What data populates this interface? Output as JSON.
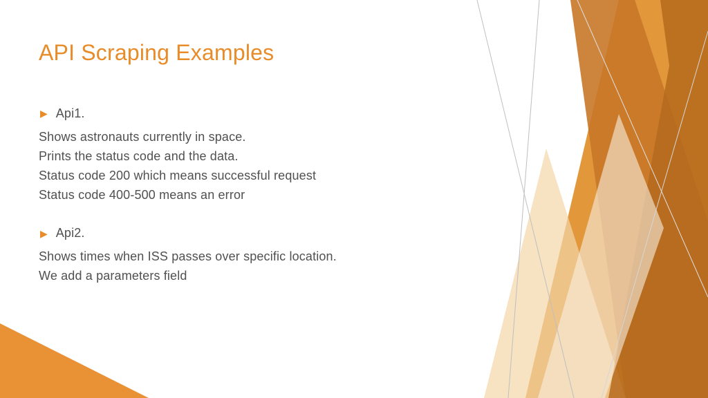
{
  "title": "API Scraping Examples",
  "sections": [
    {
      "label": "Api1.",
      "lines": [
        "Shows astronauts currently in space.",
        "Prints the status code and the data.",
        "Status code 200 which means successful request",
        "Status code 400-500 means an error"
      ]
    },
    {
      "label": "Api2.",
      "lines": [
        "Shows times when ISS passes over specific location.",
        "We add a parameters field"
      ]
    }
  ],
  "colors": {
    "accent": "#E88C2A",
    "text": "#505050"
  }
}
